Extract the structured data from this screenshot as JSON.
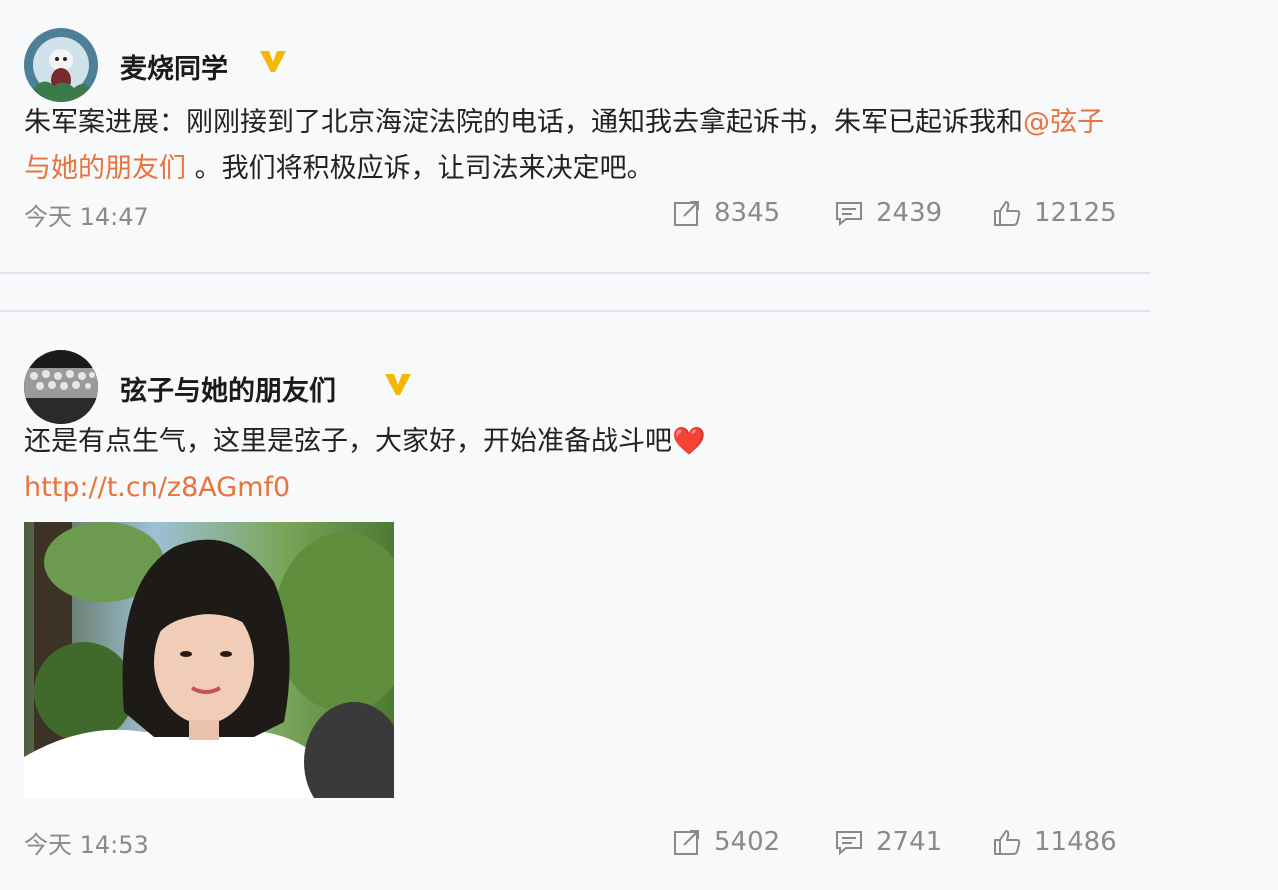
{
  "posts": [
    {
      "username": "麦烧同学",
      "verified_icon": "verified-v-badge-icon",
      "text_before": "朱军案进展：刚刚接到了北京海淀法院的电话，通知我去拿起诉书，朱军已起诉我和",
      "mention": "@弦子与她的朋友们",
      "text_after": " 。我们将积极应诉，让司法来决定吧。",
      "time": "今天 14:47",
      "reposts": "8345",
      "comments": "2439",
      "likes": "12125"
    },
    {
      "username": "弦子与她的朋友们",
      "verified_icon": "verified-v-badge-icon",
      "text": "还是有点生气，这里是弦子，大家好，开始准备战斗吧",
      "emoji": "❤️",
      "link": "http://t.cn/z8AGmf0",
      "time": "今天 14:53",
      "reposts": "5402",
      "comments": "2741",
      "likes": "11486"
    }
  ],
  "colors": {
    "accent": "#e8743b",
    "verified": "#f5b800",
    "muted": "#8a8a8a"
  }
}
